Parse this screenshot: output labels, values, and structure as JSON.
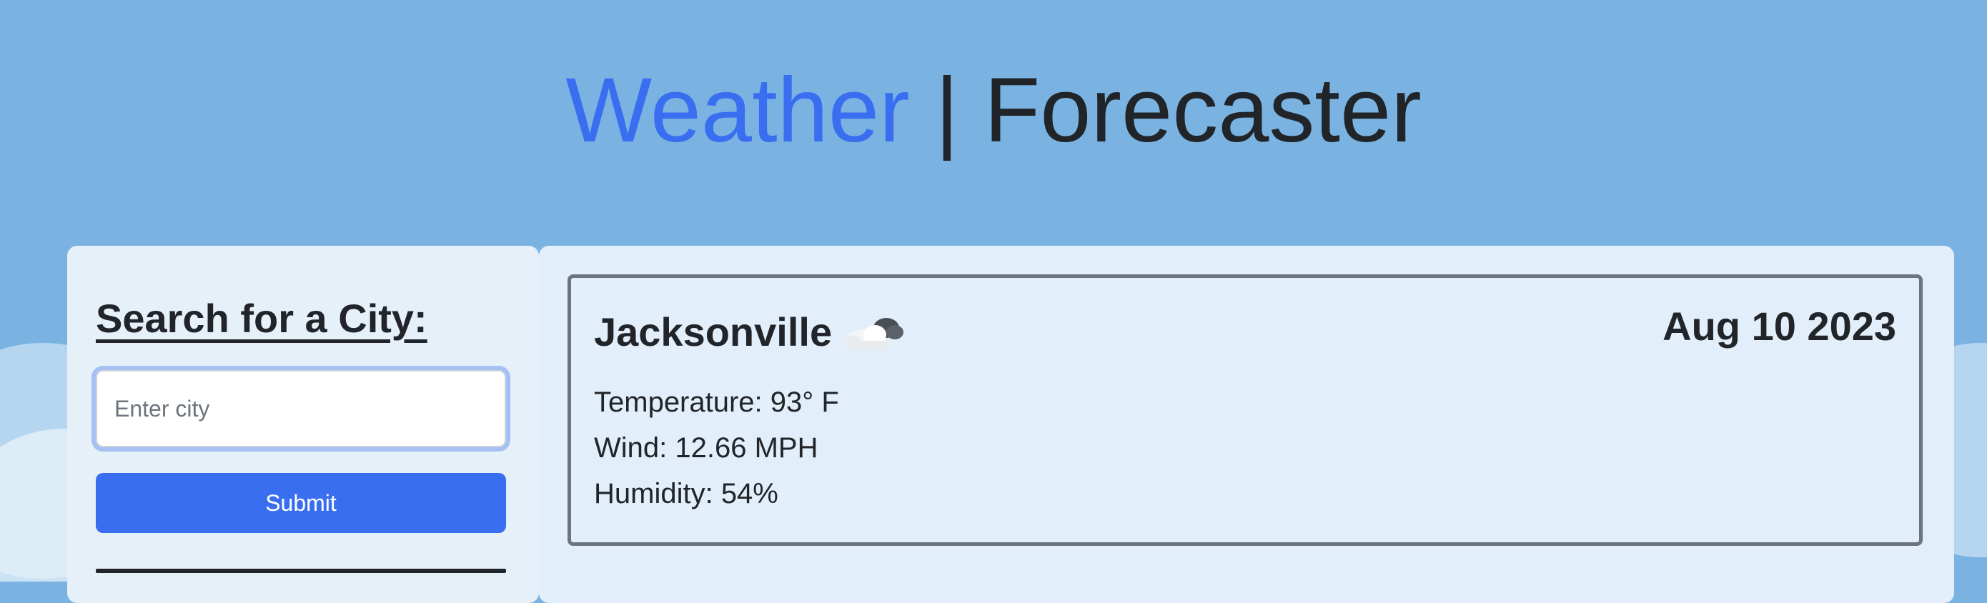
{
  "header": {
    "title_brand": "Weather",
    "title_separator": "|",
    "title_rest": "Forecaster",
    "brand_color": "#3a6ef0"
  },
  "sidebar": {
    "heading": "Search for a City:",
    "search": {
      "placeholder": "Enter city",
      "value": ""
    },
    "submit_label": "Submit",
    "submit_color": "#3a6ef0"
  },
  "current": {
    "city": "Jacksonville",
    "icon": "cloud-icon",
    "date": "Aug 10 2023",
    "temperature": "Temperature: 93° F",
    "wind": "Wind: 12.66 MPH",
    "humidity": "Humidity: 54%"
  }
}
